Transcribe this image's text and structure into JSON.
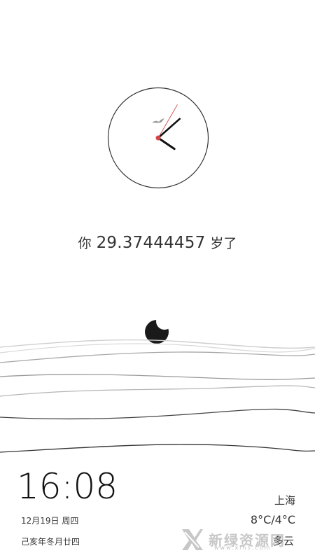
{
  "clock": {
    "hour": 16,
    "minute": 8,
    "second": 5
  },
  "age": {
    "prefix": "你",
    "value": "29.37444457",
    "suffix": "岁了"
  },
  "status": {
    "time": "16:08",
    "date": "12月19日 周四",
    "lunar": "己亥年冬月廿四",
    "city": "上海",
    "temperature": "8°C/4°C",
    "condition": "多云"
  },
  "watermark": {
    "text": "新绿资源网",
    "url": "www.xlhs.com"
  },
  "colors": {
    "second_hand": "#d05050",
    "hands": "#111111",
    "moon": "#1a1a1a"
  }
}
